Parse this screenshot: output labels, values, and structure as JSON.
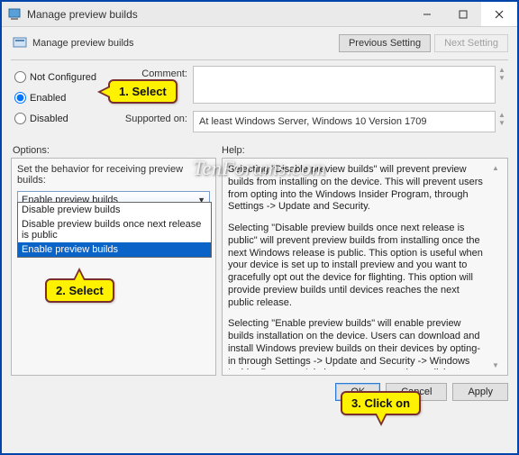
{
  "window": {
    "title": "Manage preview builds"
  },
  "header": {
    "title": "Manage preview builds",
    "prev": "Previous Setting",
    "next": "Next Setting"
  },
  "radios": {
    "not_configured": "Not Configured",
    "enabled": "Enabled",
    "disabled": "Disabled"
  },
  "fields": {
    "comment_label": "Comment:",
    "supported_label": "Supported on:",
    "supported_text": "At least Windows Server, Windows 10 Version 1709"
  },
  "section_labels": {
    "options": "Options:",
    "help": "Help:"
  },
  "options": {
    "heading": "Set the behavior for receiving preview builds:",
    "selected": "Enable preview builds",
    "items": [
      "Disable preview builds",
      "Disable preview builds once next release is public",
      "Enable preview builds"
    ]
  },
  "help": {
    "p1": "Selecting \"Disable preview builds\" will prevent preview builds from installing on the device. This will prevent users from opting into the Windows Insider Program, through Settings -> Update and Security.",
    "p2": "Selecting \"Disable preview builds once next release is public\" will prevent preview builds from installing once the next Windows release is public. This option is useful when your device is set up to install preview and you want to gracefully opt out the device for flighting. This option will provide preview builds until devices reaches the next public release.",
    "p3": "Selecting \"Enable preview builds\" will enable preview builds installation on the device. Users can download and install Windows preview builds on their devices by opting-in through Settings -> Update and Security -> Windows Insider Program. Admins can also use other policies to manage flight settings on behalf of users when this value is set."
  },
  "buttons": {
    "ok": "OK",
    "cancel": "Cancel",
    "apply": "Apply"
  },
  "callouts": {
    "c1": "1. Select",
    "c2": "2. Select",
    "c3": "3. Click on"
  },
  "watermark": "TenForums.com"
}
